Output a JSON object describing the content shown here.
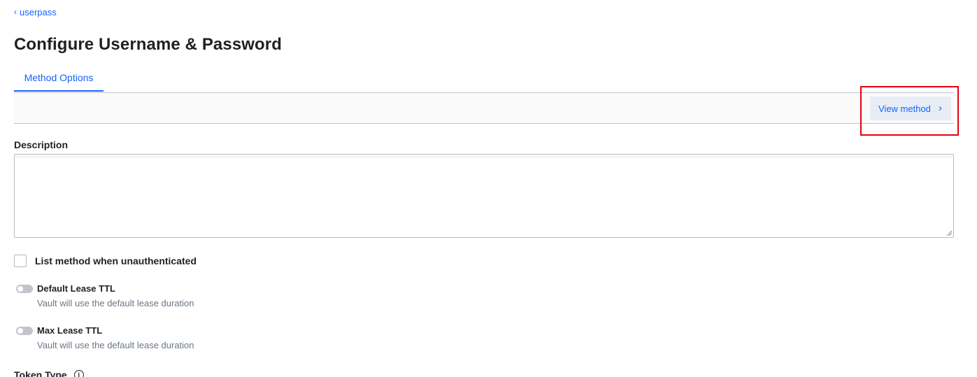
{
  "breadcrumb": {
    "chevron": "‹",
    "label": "userpass"
  },
  "page": {
    "title": "Configure Username & Password"
  },
  "tabs": [
    {
      "label": "Method Options",
      "active": true
    }
  ],
  "toolbar": {
    "view_method_label": "View method",
    "chevron": "›"
  },
  "form": {
    "description": {
      "label": "Description",
      "value": ""
    },
    "list_unauthenticated": {
      "label": "List method when unauthenticated",
      "checked": false
    },
    "default_lease_ttl": {
      "title": "Default Lease TTL",
      "help": "Vault will use the default lease duration",
      "enabled": false
    },
    "max_lease_ttl": {
      "title": "Max Lease TTL",
      "help": "Vault will use the default lease duration",
      "enabled": false
    },
    "token_type": {
      "label": "Token Type",
      "info_icon": "i"
    }
  },
  "colors": {
    "accent": "#1563ff",
    "highlight": "#e3000f",
    "toolbar_bg": "#fafafa",
    "button_bg": "#e8edf5"
  }
}
